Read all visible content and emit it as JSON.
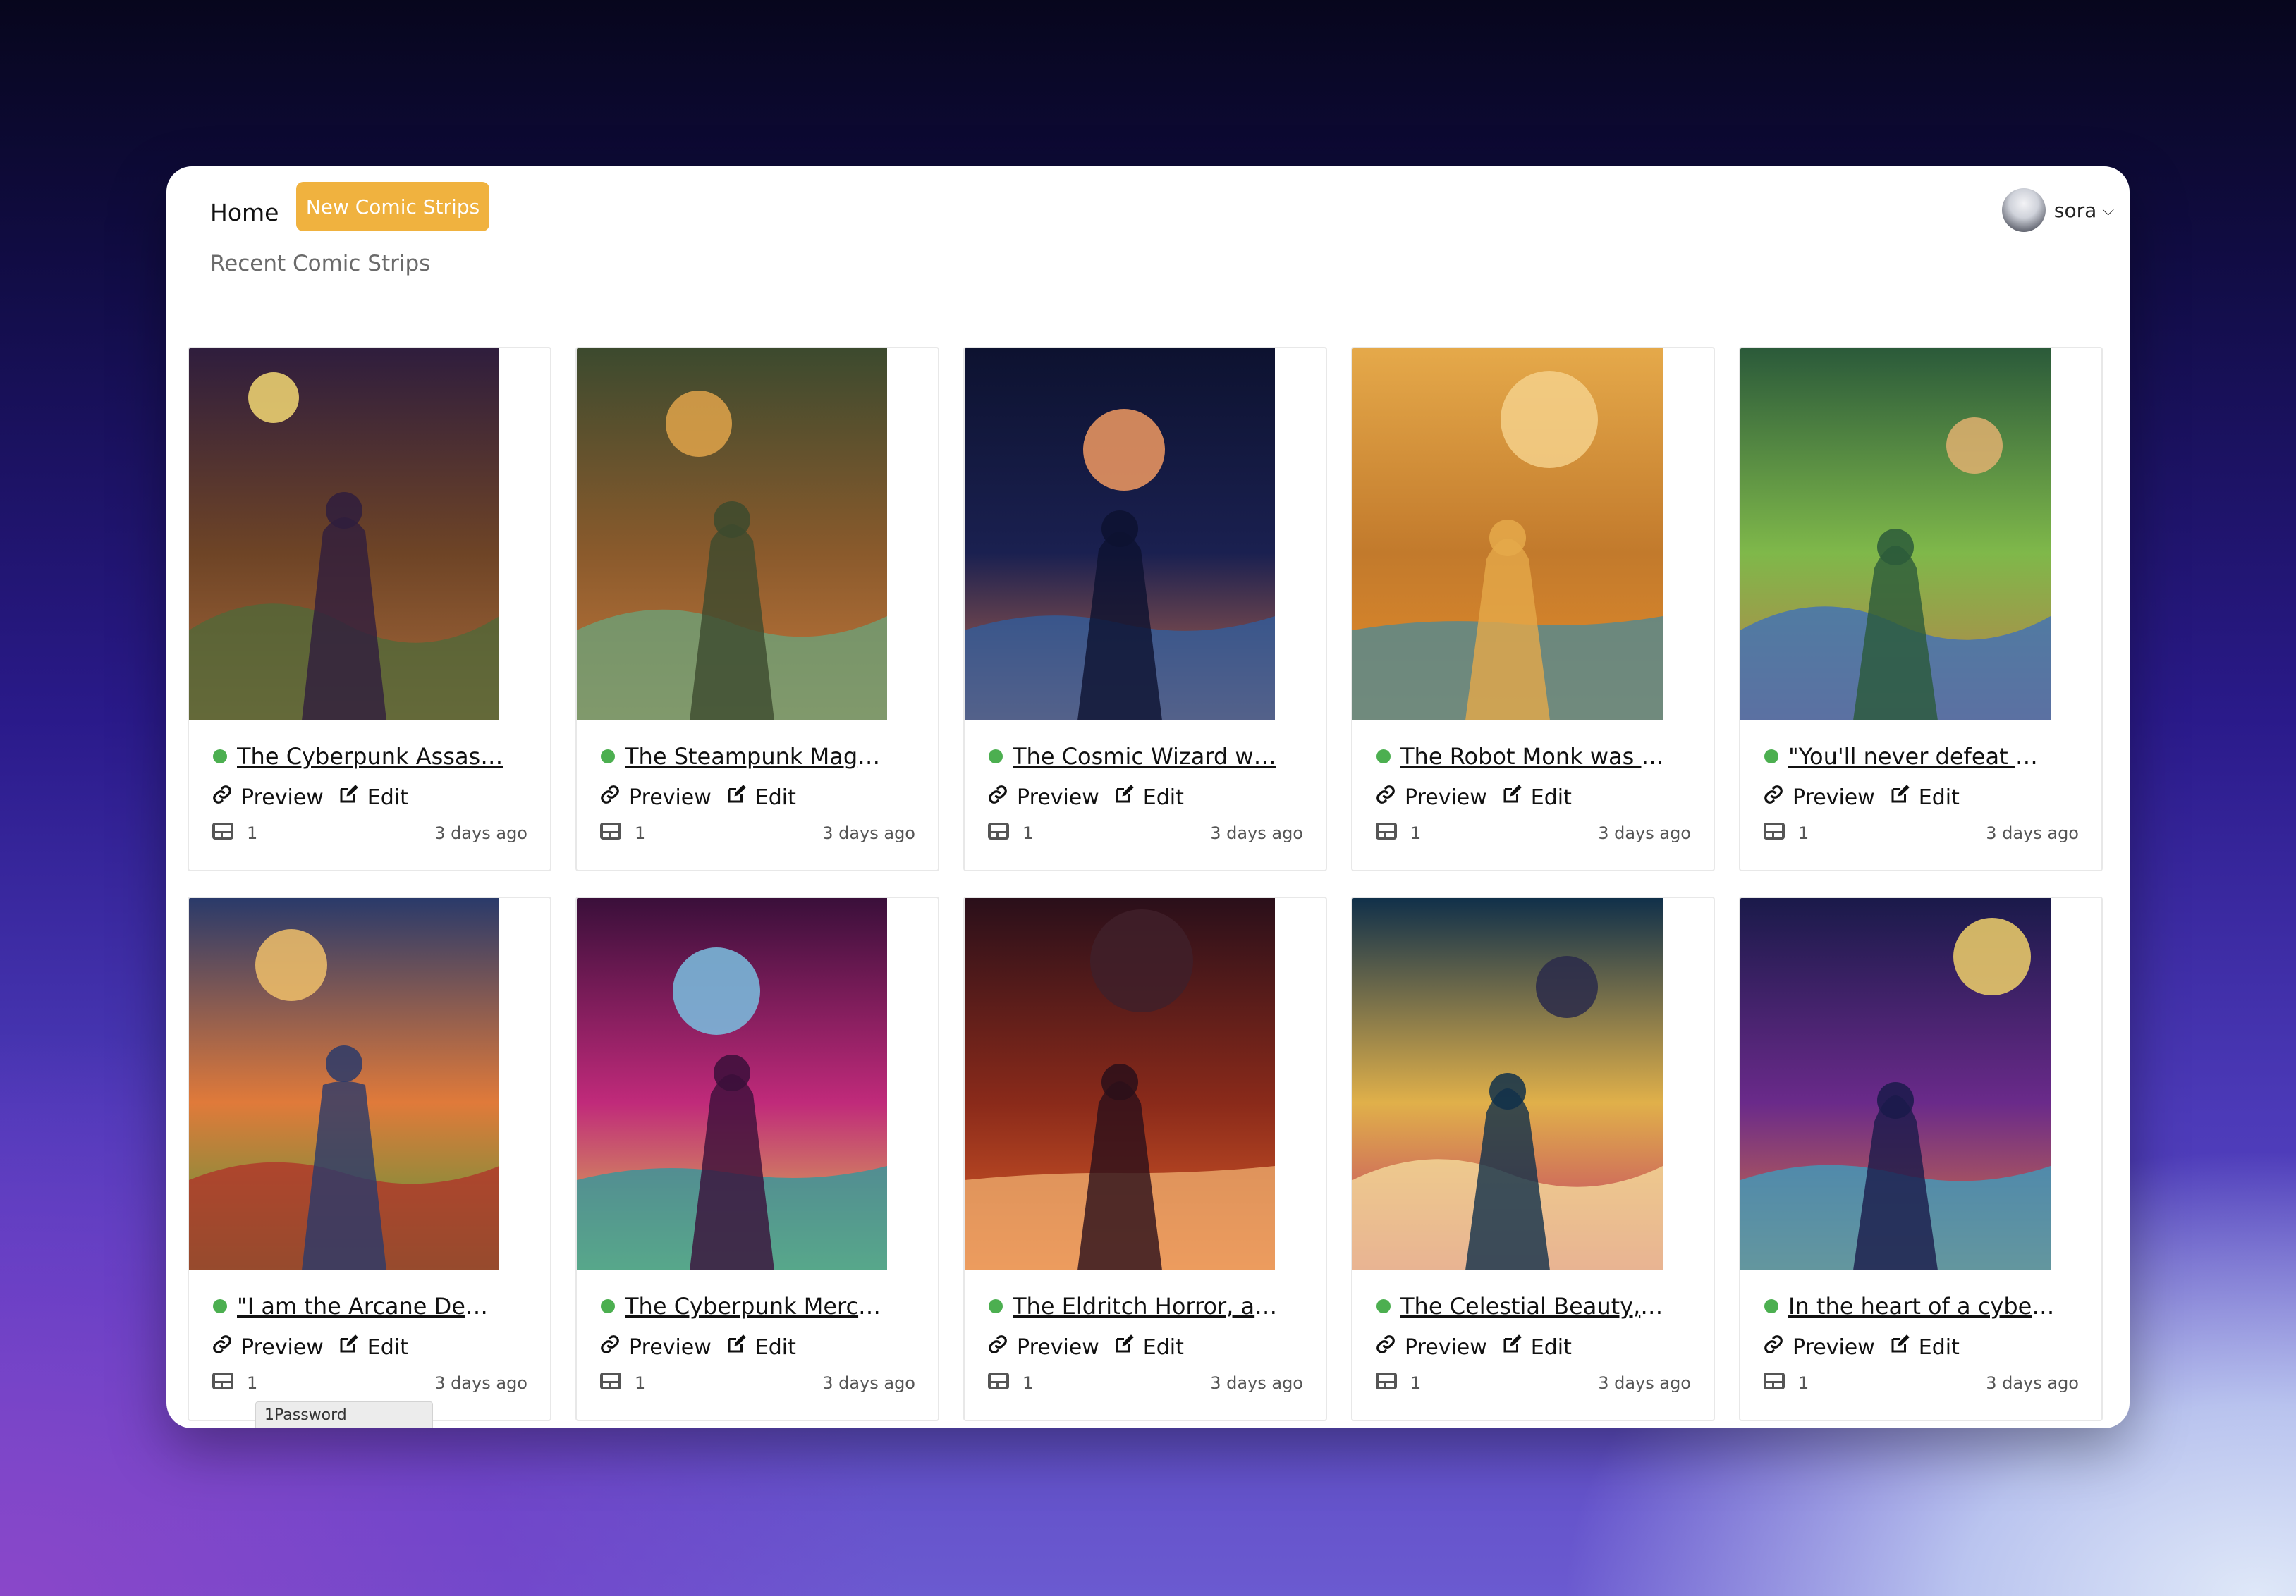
{
  "nav": {
    "home_label": "Home",
    "new_button_label": "New Comic Strips"
  },
  "user": {
    "name": "sora"
  },
  "section": {
    "title": "Recent Comic Strips"
  },
  "strips": [
    {
      "title": "The Cyberpunk Assas…",
      "panels": "1",
      "time": "3 days ago",
      "preview_label": "Preview",
      "edit_label": "Edit",
      "palette": [
        "#2f1d3d",
        "#6e4426",
        "#a86a3a",
        "#4e6a3a",
        "#f3d873"
      ]
    },
    {
      "title": "The Steampunk Mage …",
      "panels": "1",
      "time": "3 days ago",
      "preview_label": "Preview",
      "edit_label": "Edit",
      "palette": [
        "#3c4a2e",
        "#8a5a2c",
        "#c5793c",
        "#6aa47c",
        "#e0a34a"
      ]
    },
    {
      "title": "The Cosmic Wizard w…",
      "panels": "1",
      "time": "3 days ago",
      "preview_label": "Preview",
      "edit_label": "Edit",
      "palette": [
        "#0d1230",
        "#1a2050",
        "#c26a4a",
        "#2f5fa0",
        "#f19a61"
      ]
    },
    {
      "title": "The Robot Monk was s…",
      "panels": "1",
      "time": "3 days ago",
      "preview_label": "Preview",
      "edit_label": "Edit",
      "palette": [
        "#e5a94a",
        "#c27a2c",
        "#e58c2a",
        "#4a8a9a",
        "#f5d08a"
      ]
    },
    {
      "title": "\"You'll never defeat m…",
      "panels": "1",
      "time": "3 days ago",
      "preview_label": "Preview",
      "edit_label": "Edit",
      "palette": [
        "#2b5a3a",
        "#7fb84a",
        "#c07a4a",
        "#3a6ec0",
        "#e0b070"
      ]
    },
    {
      "title": "\"I am the Arcane Dem…",
      "panels": "1",
      "time": "3 days ago",
      "preview_label": "Preview",
      "edit_label": "Edit",
      "palette": [
        "#2a3a6a",
        "#e07a3a",
        "#4a9a3a",
        "#b0302a",
        "#f0c06a"
      ]
    },
    {
      "title": "The Cyberpunk Merce…",
      "panels": "1",
      "time": "3 days ago",
      "preview_label": "Preview",
      "edit_label": "Edit",
      "palette": [
        "#3a0f3a",
        "#c02a7a",
        "#e0d04a",
        "#2a9aa0",
        "#7ac0e0"
      ]
    },
    {
      "title": "The Eldritch Horror, a …",
      "panels": "1",
      "time": "3 days ago",
      "preview_label": "Preview",
      "edit_label": "Edit",
      "palette": [
        "#2a0f1a",
        "#8a2a1a",
        "#e0602a",
        "#f0b070",
        "#40202a"
      ]
    },
    {
      "title": "The Celestial Beauty, …",
      "panels": "1",
      "time": "3 days ago",
      "preview_label": "Preview",
      "edit_label": "Edit",
      "palette": [
        "#10304a",
        "#e0b04a",
        "#c0306a",
        "#f5e0a0",
        "#2a2a4a"
      ]
    },
    {
      "title": "In the heart of a cyber…",
      "panels": "1",
      "time": "3 days ago",
      "preview_label": "Preview",
      "edit_label": "Edit",
      "palette": [
        "#1a1a4a",
        "#6a2a8a",
        "#e07a3a",
        "#3aa0c0",
        "#f0d06a"
      ]
    }
  ],
  "overlay": {
    "password_manager_label": "1Password"
  },
  "colors": {
    "accent": "#f0b23f",
    "status_dot": "#4caf50"
  }
}
